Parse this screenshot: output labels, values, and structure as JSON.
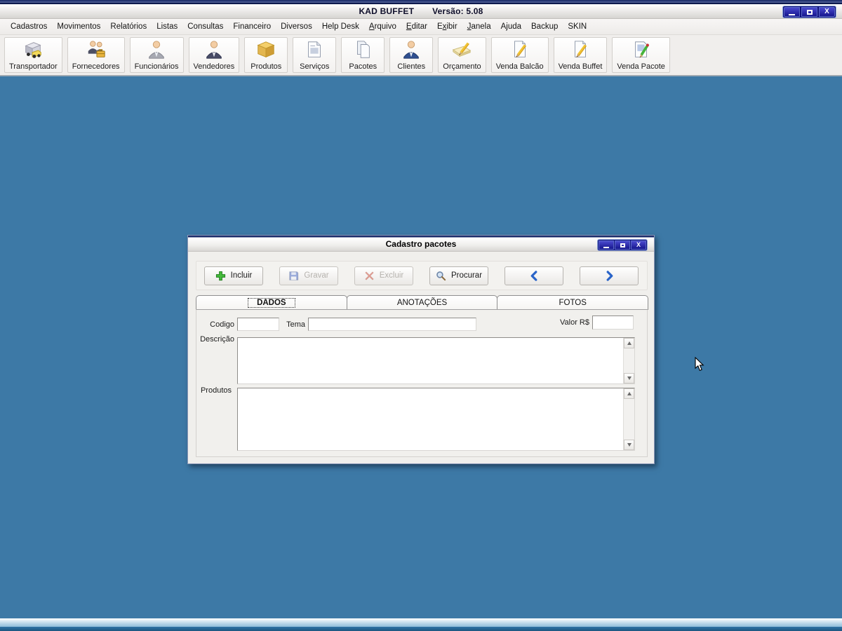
{
  "window": {
    "app_name": "KAD BUFFET",
    "version_label": "Versão: 5.08"
  },
  "menu_bar": {
    "items": [
      {
        "pre": "Cadastros",
        "key": "",
        "post": ""
      },
      {
        "pre": "Movimentos",
        "key": "",
        "post": ""
      },
      {
        "pre": "Relatórios",
        "key": "",
        "post": ""
      },
      {
        "pre": "Listas",
        "key": "",
        "post": ""
      },
      {
        "pre": "Consultas",
        "key": "",
        "post": ""
      },
      {
        "pre": "Financeiro",
        "key": "",
        "post": ""
      },
      {
        "pre": "Diversos",
        "key": "",
        "post": ""
      },
      {
        "pre": "Help Desk",
        "key": "",
        "post": ""
      },
      {
        "pre": "",
        "key": "A",
        "post": "rquivo"
      },
      {
        "pre": "",
        "key": "E",
        "post": "ditar"
      },
      {
        "pre": "E",
        "key": "x",
        "post": "ibir"
      },
      {
        "pre": "",
        "key": "J",
        "post": "anela"
      },
      {
        "pre": "Ajuda",
        "key": "",
        "post": ""
      },
      {
        "pre": "Backup",
        "key": "",
        "post": ""
      },
      {
        "pre": "SKIN",
        "key": "",
        "post": ""
      }
    ]
  },
  "toolbar": {
    "items": [
      {
        "label": "Transportador",
        "icon": "truck-icon"
      },
      {
        "label": "Fornecedores",
        "icon": "suppliers-people-icon"
      },
      {
        "label": "Funcionários",
        "icon": "employee-person-icon"
      },
      {
        "label": "Vendedores",
        "icon": "salesperson-icon"
      },
      {
        "label": "Produtos",
        "icon": "box-icon"
      },
      {
        "label": "Serviços",
        "icon": "document-icon"
      },
      {
        "label": "Pacotes",
        "icon": "pages-icon"
      },
      {
        "label": "Clientes",
        "icon": "client-person-icon"
      },
      {
        "label": "Orçamento",
        "icon": "pencil-note-icon"
      },
      {
        "label": "Venda Balcão",
        "icon": "page-pencil-yellow-icon"
      },
      {
        "label": "Venda Buffet",
        "icon": "page-pencil-yellow-icon"
      },
      {
        "label": "Venda Pacote",
        "icon": "page-pencil-green-icon"
      }
    ]
  },
  "dialog": {
    "title": "Cadastro pacotes",
    "buttons": [
      {
        "label": "Incluir",
        "icon": "plus-icon",
        "enabled": true
      },
      {
        "label": "Gravar",
        "icon": "save-icon",
        "enabled": false
      },
      {
        "label": "Excluir",
        "icon": "delete-icon",
        "enabled": false
      },
      {
        "label": "Procurar",
        "icon": "search-icon",
        "enabled": true
      }
    ],
    "nav": {
      "prev_icon": "chevron-left-icon",
      "next_icon": "chevron-right-icon"
    },
    "tabs": [
      {
        "label": "DADOS",
        "active": true
      },
      {
        "label": "ANOTAÇÕES",
        "active": false
      },
      {
        "label": "FOTOS",
        "active": false
      }
    ],
    "fields": {
      "codigo_label": "Codigo",
      "codigo_value": "",
      "tema_label": "Tema",
      "tema_value": "",
      "valor_label": "Valor R$",
      "valor_value": "",
      "descricao_label": "Descrição",
      "descricao_value": "",
      "produtos_label": "Produtos",
      "produtos_value": ""
    }
  },
  "colors": {
    "mdi_background": "#3d79a6",
    "chrome_background": "#f0eeec",
    "title_button_blue": "#16168e",
    "accent_blue": "#2a64c8",
    "plus_green": "#46bb3c",
    "delete_red": "#d63a22",
    "disabled_text": "#b5b2ad"
  },
  "icons": {
    "window": [
      "minimize-icon",
      "maximize-icon",
      "close-icon"
    ],
    "scrollbar": [
      "scroll-up-icon",
      "scroll-down-icon"
    ],
    "pointer": "mouse-cursor"
  }
}
